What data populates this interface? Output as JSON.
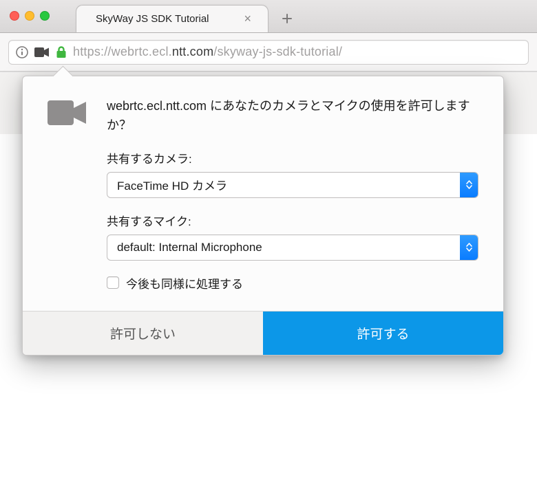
{
  "tab": {
    "title": "SkyWay JS SDK Tutorial"
  },
  "urlbar": {
    "prefix": "https://webrtc.ecl.",
    "dark": "ntt.com",
    "suffix": "/skyway-js-sdk-tutorial/"
  },
  "popup": {
    "question": "webrtc.ecl.ntt.com にあなたのカメラとマイクの使用を許可しますか？",
    "camera_label": "共有するカメラ:",
    "camera_value": "FaceTime HD カメラ",
    "mic_label": "共有するマイク:",
    "mic_value": "default: Internal Microphone",
    "remember_label": "今後も同様に処理する",
    "deny_label": "許可しない",
    "allow_label": "許可する"
  },
  "colors": {
    "accent": "#0c97e8",
    "lock_green": "#3fb63f"
  }
}
